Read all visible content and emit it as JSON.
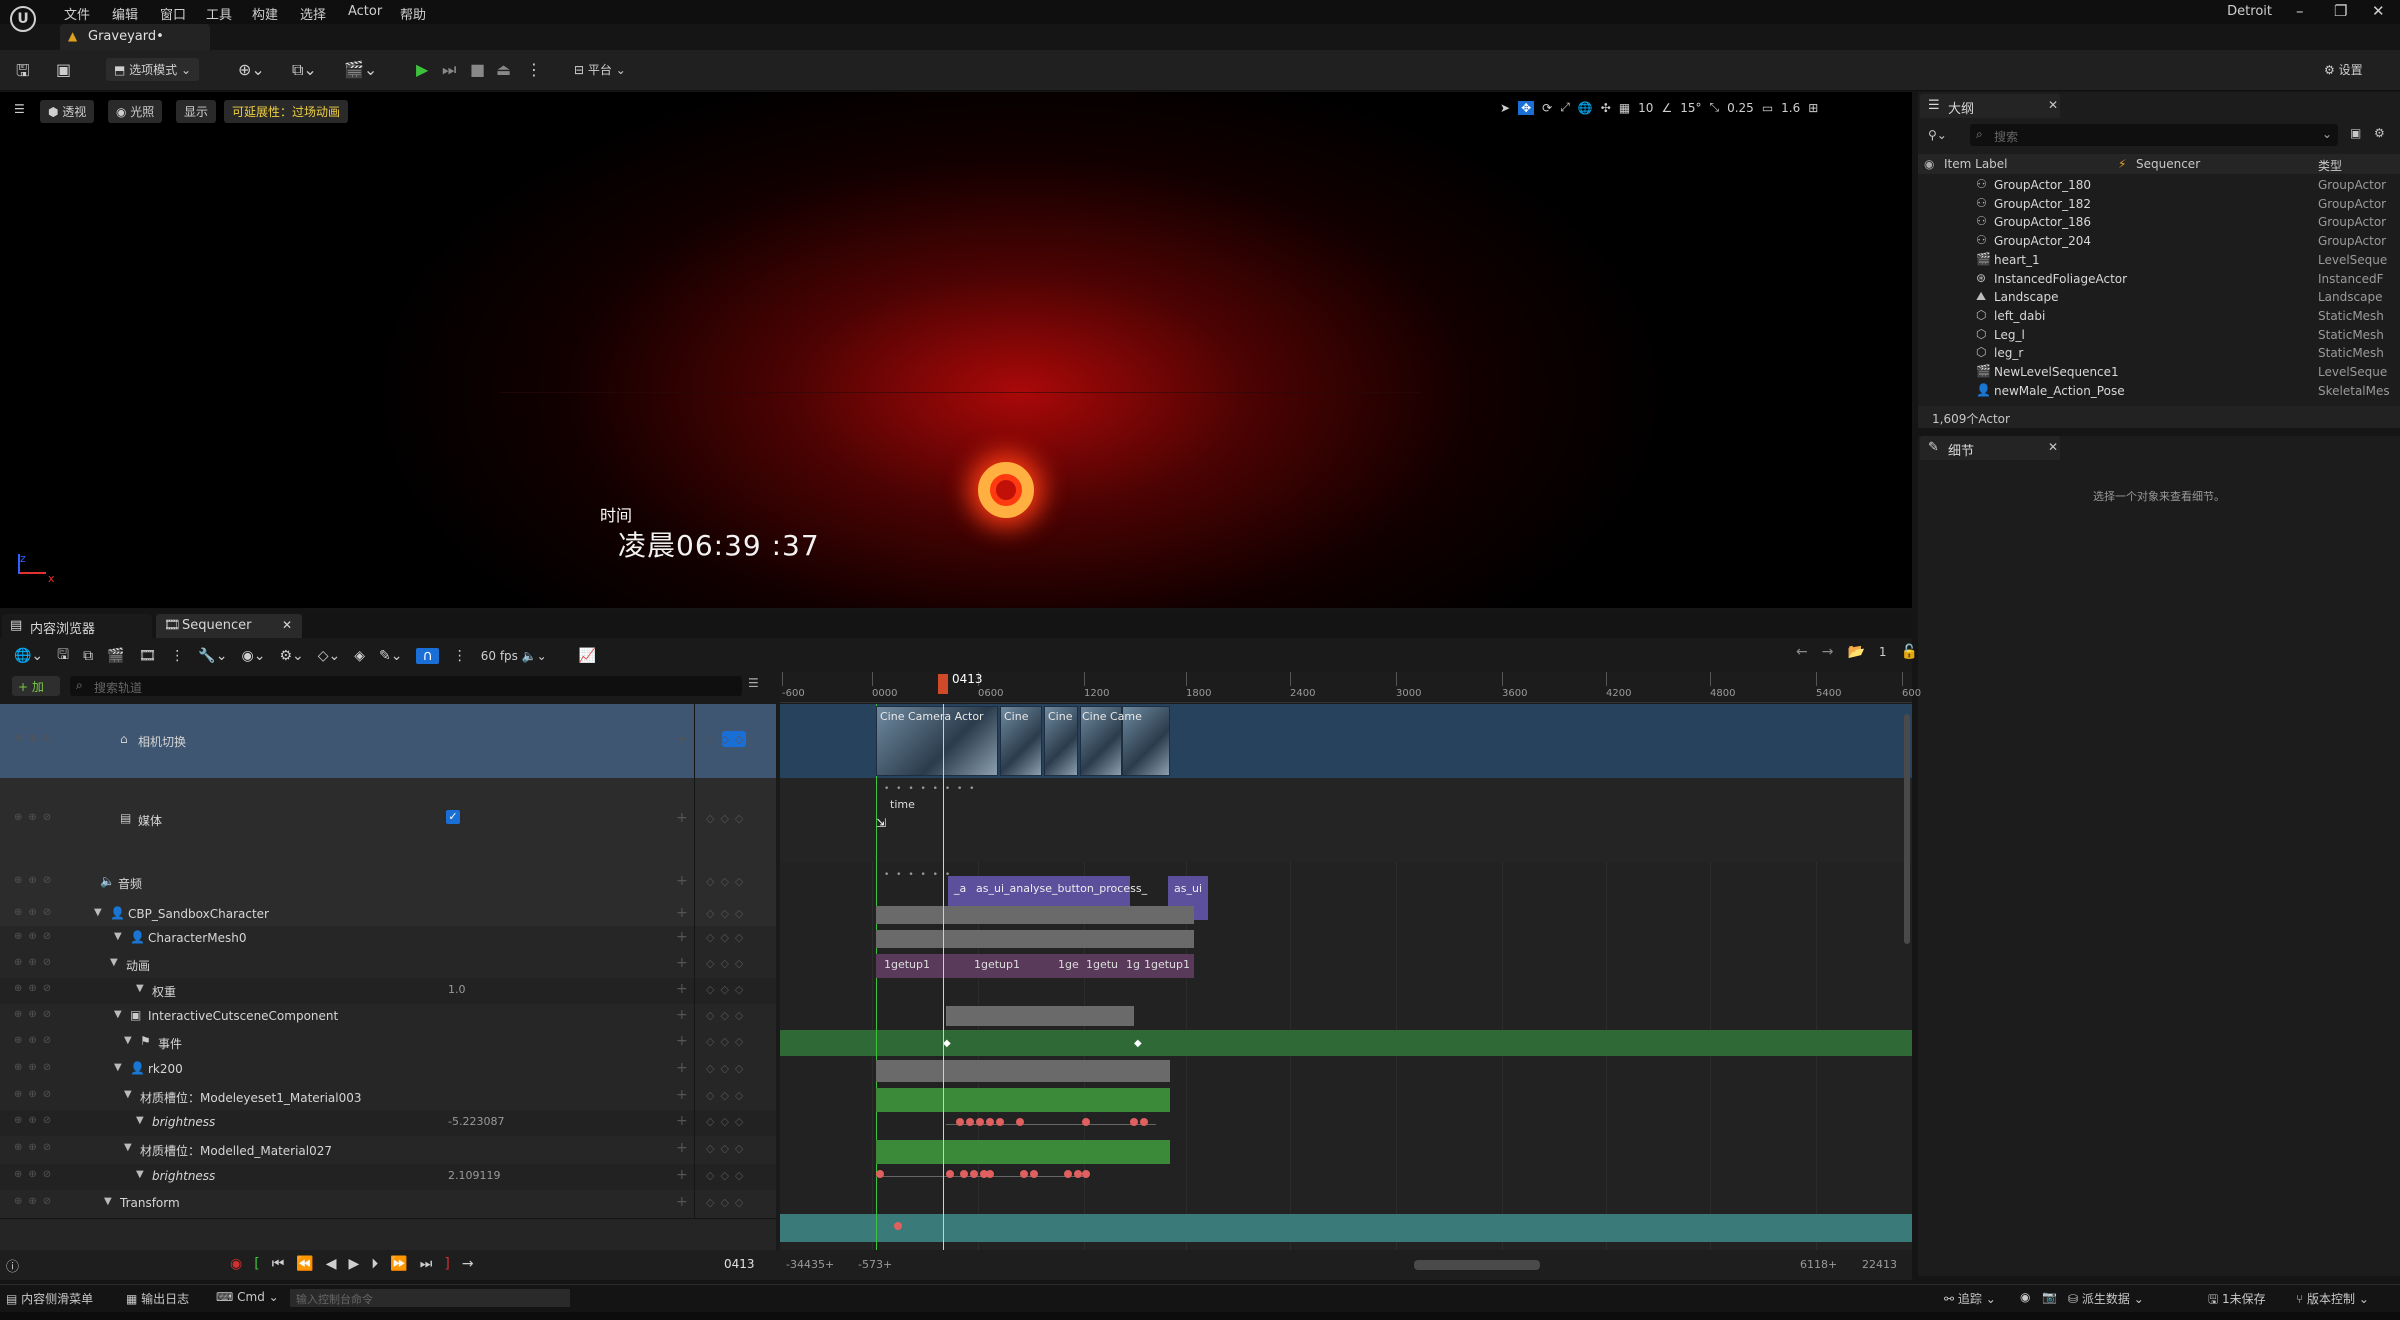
{
  "menu": [
    "文件",
    "编辑",
    "窗口",
    "工具",
    "构建",
    "选择",
    "Actor",
    "帮助"
  ],
  "project_name": "Detroit",
  "level_tab": "Graveyard•",
  "window_controls": [
    "minimize-icon",
    "restore-icon",
    "close-icon"
  ],
  "toolbar": {
    "mode_label": "选项模式",
    "platform_label": "平台",
    "settings_label": "设置"
  },
  "viewport": {
    "perspective": "透视",
    "lighting": "光照",
    "show": "显示",
    "scalability": "可延展性：过场动画",
    "grid_value": "10",
    "rotation_value": "15°",
    "scale_value": "0.25",
    "camera_speed": "1.6",
    "overlay_label": "时间",
    "overlay_time": "凌晨06:39 :37",
    "axis_z": "z",
    "axis_x": "x"
  },
  "outliner": {
    "tab": "大纲",
    "search_placeholder": "搜索",
    "col_label": "Item Label",
    "col_sequencer": "Sequencer",
    "col_type": "类型",
    "rows": [
      {
        "name": "GroupActor_180",
        "type": "GroupActor"
      },
      {
        "name": "GroupActor_182",
        "type": "GroupActor"
      },
      {
        "name": "GroupActor_186",
        "type": "GroupActor"
      },
      {
        "name": "GroupActor_204",
        "type": "GroupActor"
      },
      {
        "name": "heart_1",
        "type": "LevelSeque"
      },
      {
        "name": "InstancedFoliageActor",
        "type": "InstancedF"
      },
      {
        "name": "Landscape",
        "type": "Landscape"
      },
      {
        "name": "left_dabi",
        "type": "StaticMesh"
      },
      {
        "name": "Leg_l",
        "type": "StaticMesh"
      },
      {
        "name": "leg_r",
        "type": "StaticMesh"
      },
      {
        "name": "NewLevelSequence1",
        "type": "LevelSeque"
      },
      {
        "name": "newMale_Action_Pose",
        "type": "SkeletalMes"
      }
    ],
    "count": "1,609个Actor"
  },
  "details": {
    "tab": "细节",
    "empty_text": "选择一个对象来查看细节。"
  },
  "content_browser_tab": "内容浏览器",
  "sequencer": {
    "tab": "Sequencer",
    "fps": "60 fps",
    "add_label": "+ 加",
    "search_placeholder": "搜索轨道",
    "current_frame": "0413",
    "range_start": "-34435+",
    "view_start": "-573+",
    "view_end": "6118+",
    "range_end": "22413",
    "ticks": [
      "-600",
      "0000",
      "0600",
      "1200",
      "1800",
      "2400",
      "3000",
      "3600",
      "4200",
      "4800",
      "5400",
      "600"
    ],
    "page_counter": "1",
    "tracks": [
      {
        "label": "相机切换"
      },
      {
        "label": "媒体"
      },
      {
        "label": "音频"
      },
      {
        "label": "CBP_SandboxCharacter"
      },
      {
        "label": "CharacterMesh0"
      },
      {
        "label": "动画"
      },
      {
        "label": "权重",
        "value": "1.0"
      },
      {
        "label": "InteractiveCutsceneComponent"
      },
      {
        "label": "事件"
      },
      {
        "label": "rk200"
      },
      {
        "label": "材质槽位：Modeleyeset1_Material003"
      },
      {
        "label": "brightness",
        "value": "-5.223087"
      },
      {
        "label": "材质槽位：Modelled_Material027"
      },
      {
        "label": "brightness",
        "value": "2.109119"
      },
      {
        "label": "Transform"
      }
    ],
    "clips": {
      "camera": [
        "Cine Camera Actor",
        "Cine",
        "Cine",
        "Cine Came"
      ],
      "media": "time",
      "audio": [
        "_a",
        "as_ui_analyse_button_process_",
        "as_ui"
      ],
      "anim": [
        "1getup1",
        "1getup1",
        "1ge",
        "1getu",
        "1g",
        "1getup1"
      ]
    }
  },
  "statusbar": {
    "content_drawer": "内容侧滑菜单",
    "output_log": "输出日志",
    "cmd": "Cmd",
    "cmd_placeholder": "输入控制台命令",
    "trace": "追踪",
    "derived_data": "派生数据",
    "unsaved": "1未保存",
    "source_control": "版本控制"
  },
  "colors": {
    "accent_blue": "#1a6fd6",
    "camera_track": "#2a5a7a",
    "audio_clip": "#5c4f9c",
    "anim_clip": "#5a3a5a",
    "event_track": "#2f6a36",
    "material_track": "#3a8a3a",
    "transform_track": "#3a7a78",
    "playhead": "#d04a2a"
  }
}
